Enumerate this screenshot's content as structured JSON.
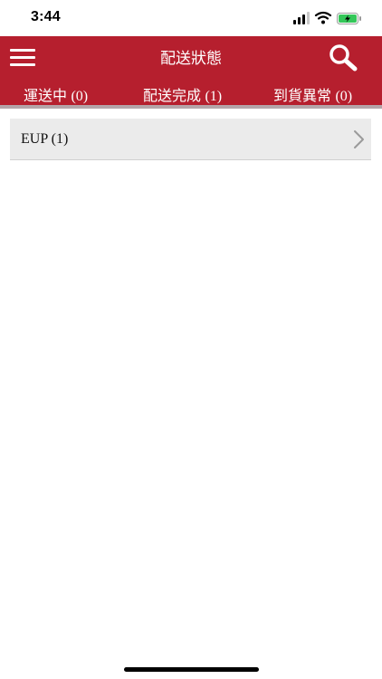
{
  "status_bar": {
    "time": "3:44"
  },
  "header": {
    "title": "配送狀態",
    "menu_icon": "hamburger-menu-icon",
    "search_icon": "search-icon",
    "background_color": "#b61f2e",
    "text_color": "#ffffff"
  },
  "tabs": [
    {
      "label": "運送中",
      "count": "(0)"
    },
    {
      "label": "配送完成",
      "count": "(1)"
    },
    {
      "label": "到貨異常",
      "count": "(0)"
    }
  ],
  "list": {
    "items": [
      {
        "label": "EUP (1)",
        "icon": "chevron-right-icon"
      }
    ]
  }
}
